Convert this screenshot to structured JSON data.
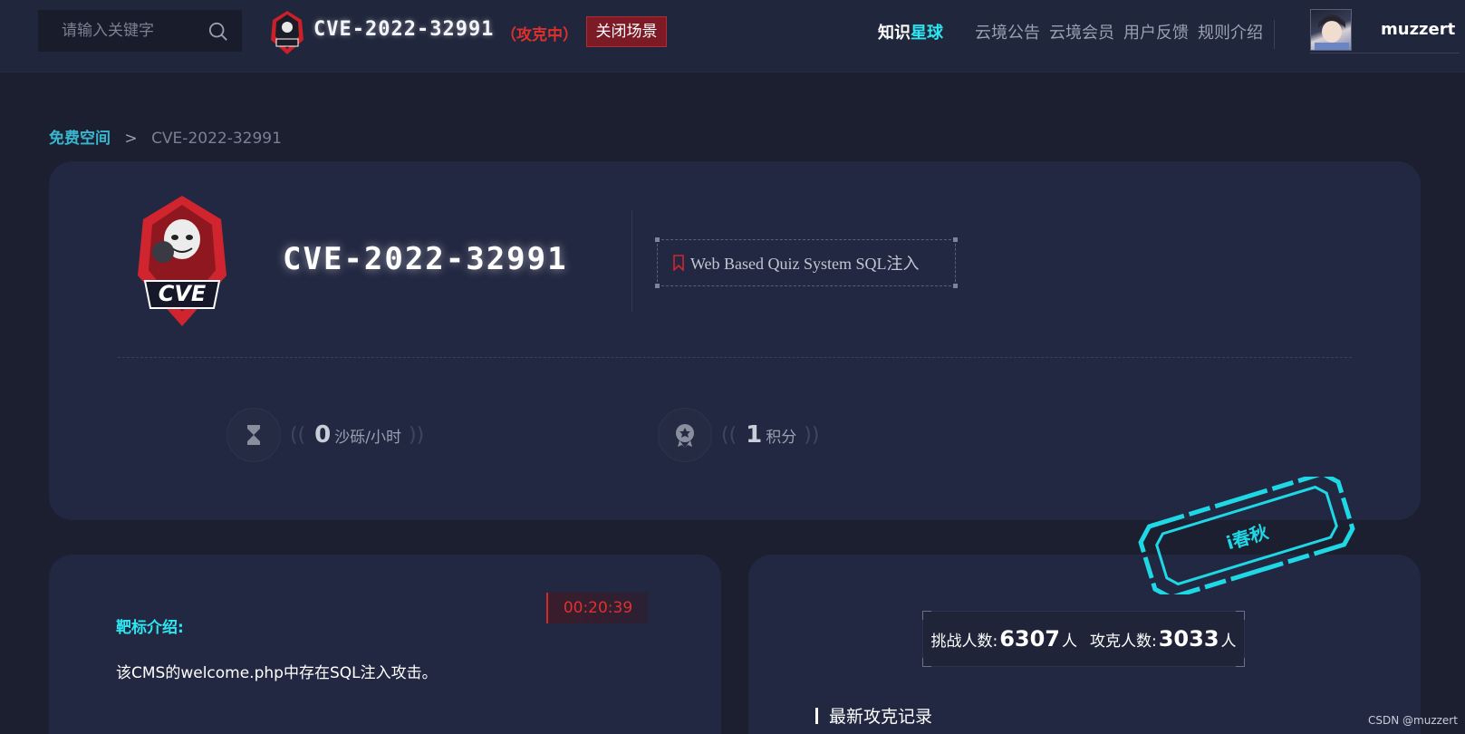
{
  "header": {
    "search_placeholder": "请输入关键字",
    "scene_title": "CVE-2022-32991",
    "scene_status": "（攻克中）",
    "close_scene": "关闭场景",
    "nav": [
      {
        "label_a": "知识",
        "label_b": "星球"
      },
      {
        "label": "云境公告"
      },
      {
        "label": "云境会员"
      },
      {
        "label": "用户反馈"
      },
      {
        "label": "规则介绍"
      }
    ],
    "username": "muzzert"
  },
  "breadcrumb": {
    "root": "免费空间",
    "separator": ">",
    "current": "CVE-2022-32991"
  },
  "scene": {
    "logo_text": "CVE",
    "title": "CVE-2022-32991",
    "tag": "Web Based Quiz System SQL注入",
    "stats": [
      {
        "value": "0",
        "unit": "沙砾/小时"
      },
      {
        "value": "1",
        "unit": "积分"
      }
    ]
  },
  "target": {
    "timer": "00:20:39",
    "intro_label": "靶标介绍:",
    "intro_text": "该CMS的welcome.php中存在SQL注入攻击。"
  },
  "records": {
    "challenge_label": "挑战人数:",
    "challenge_count": "6307",
    "challenge_unit": "人",
    "solved_label": "攻克人数:",
    "solved_count": "3033",
    "solved_unit": "人",
    "latest_title": "最新攻克记录"
  },
  "stamp": {
    "text": "i春秋"
  },
  "watermark": "CSDN @muzzert",
  "colors": {
    "accent_cyan": "#2ee6f0",
    "alert_red": "#e0302e",
    "link_blue": "#3ab5d0"
  }
}
